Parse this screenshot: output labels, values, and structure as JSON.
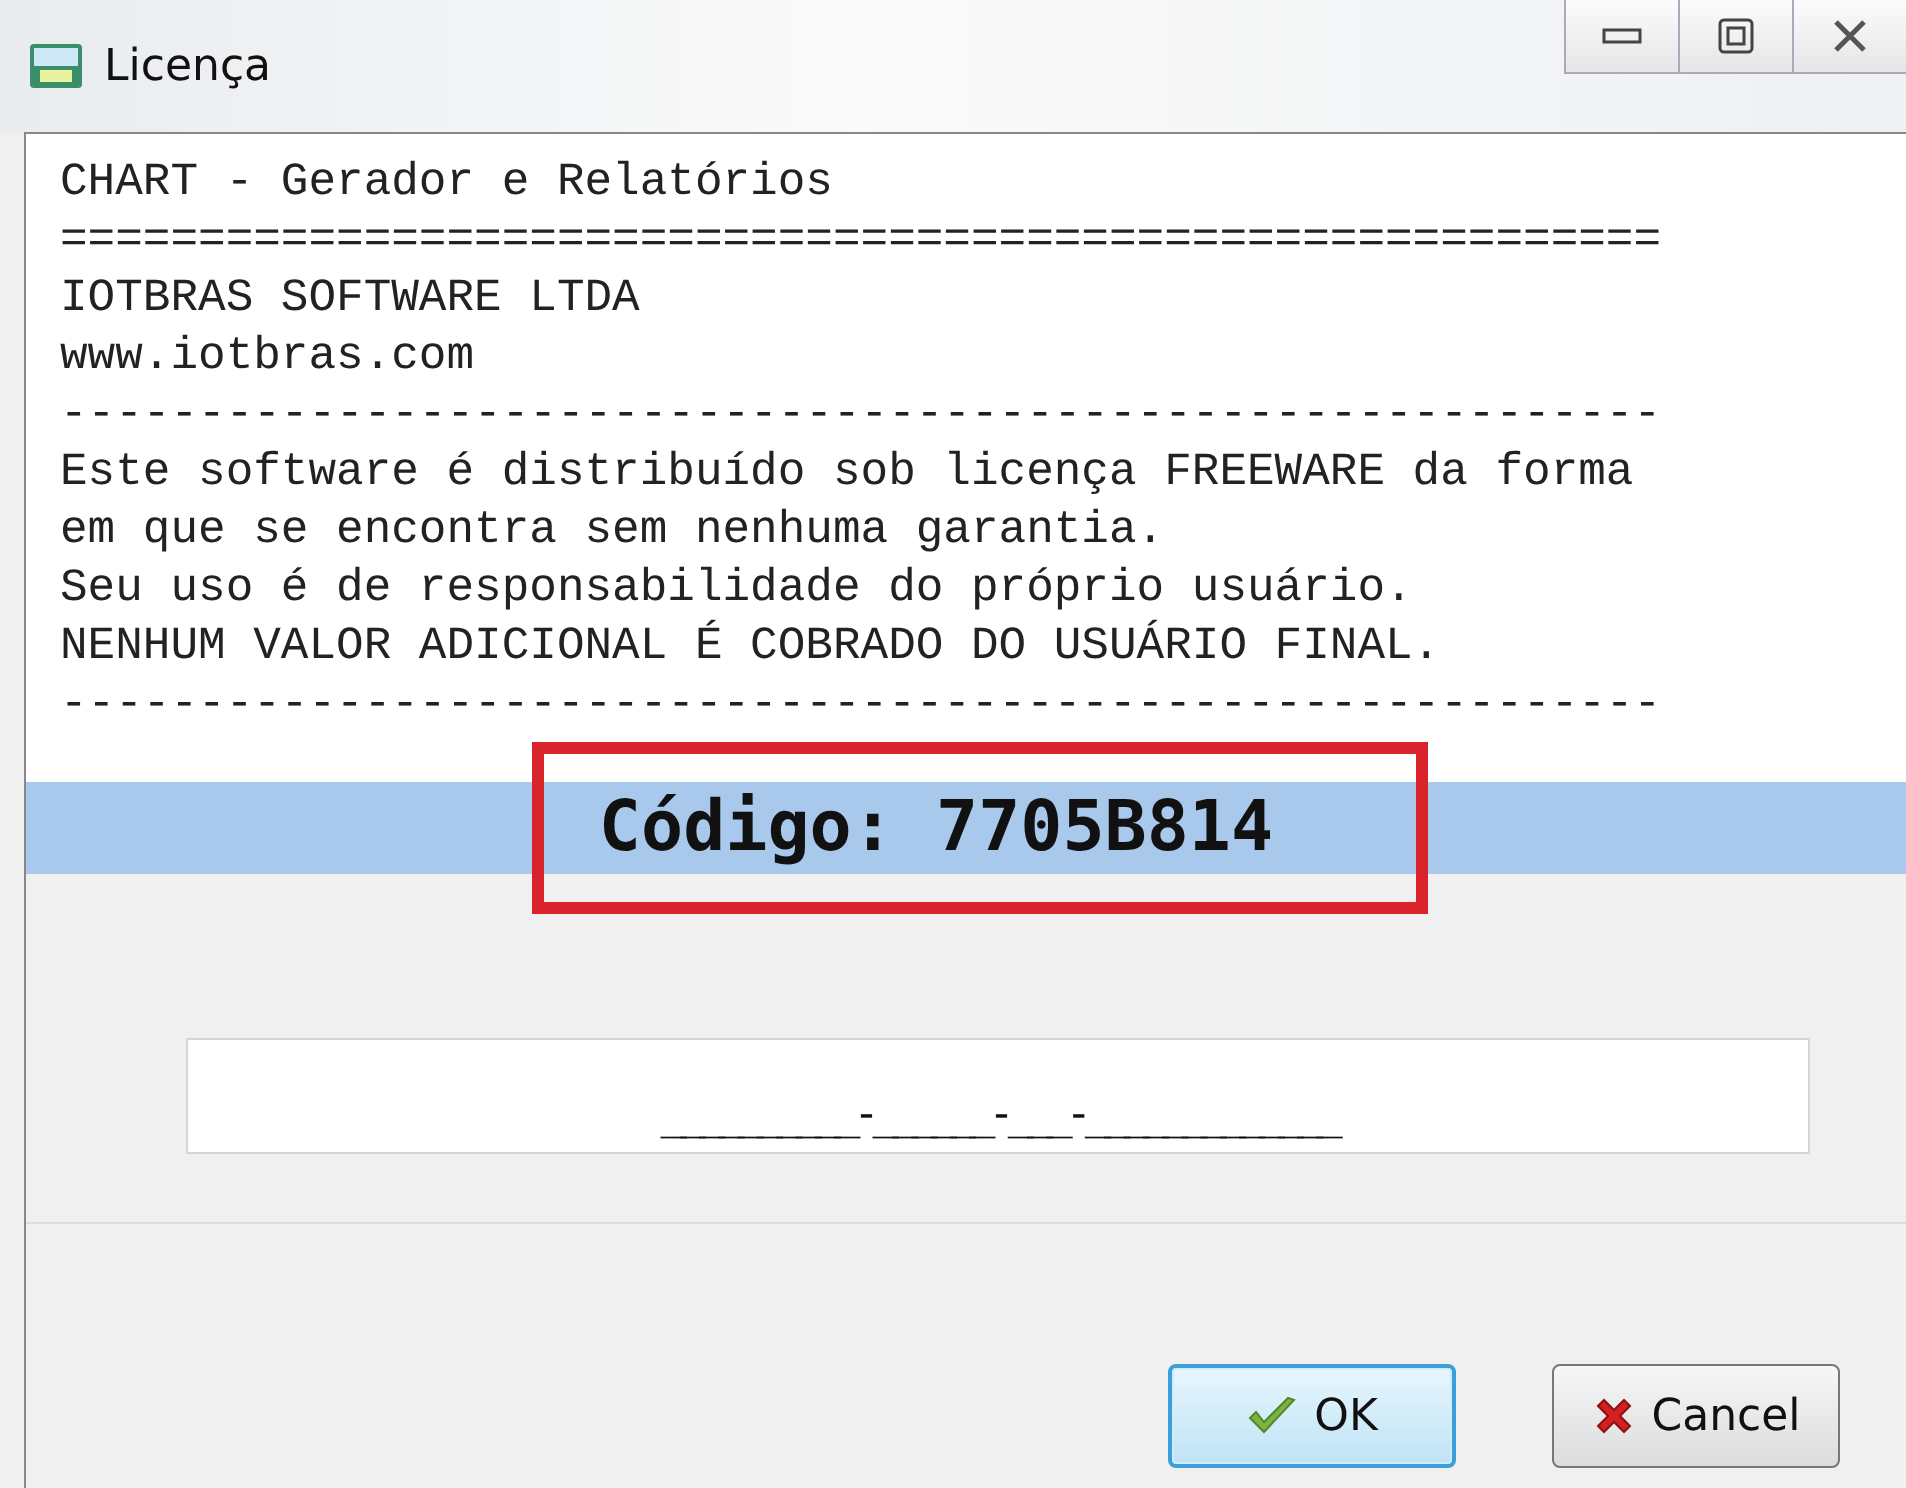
{
  "window": {
    "title": "Licença"
  },
  "license_text": [
    "CHART - Gerador e Relatórios",
    "==========================================================",
    "IOTBRAS SOFTWARE LTDA",
    "www.iotbras.com",
    "----------------------------------------------------------",
    "Este software é distribuído sob licença FREEWARE da forma",
    "em que se encontra sem nenhuma garantia.",
    "Seu uso é de responsabilidade do próprio usuário.",
    "NENHUM VALOR ADICIONAL É COBRADO DO USUÁRIO FINAL.",
    "----------------------------------------------------------"
  ],
  "code_band": {
    "text": "Código: 7705B814",
    "highlighted": true
  },
  "license_field": {
    "value": "__________-______-___-_____________"
  },
  "buttons": [
    {
      "label": "OK",
      "kind": "ok",
      "focused": true
    },
    {
      "label": "Cancel",
      "kind": "cancel",
      "focused": false
    }
  ]
}
